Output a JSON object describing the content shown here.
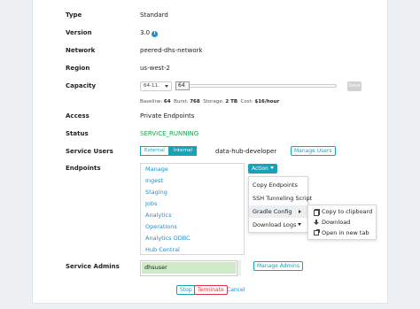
{
  "fields": {
    "type": {
      "label": "Type",
      "value": "Standard"
    },
    "version": {
      "label": "Version",
      "value": "3.0"
    },
    "network": {
      "label": "Network",
      "value": "peered-dhs-network"
    },
    "region": {
      "label": "Region",
      "value": "us-west-2"
    },
    "capacity": {
      "label": "Capacity",
      "select_value": "64-11.",
      "slider_value": "64",
      "save_label": "Save",
      "stats": {
        "baseline_label": "Baseline:",
        "baseline": "64",
        "burst_label": "Burst:",
        "burst": "768",
        "storage_label": "Storage:",
        "storage": "2 TB",
        "cost_label": "Cost:",
        "cost": "$16/hour"
      }
    },
    "access": {
      "label": "Access",
      "value": "Private Endpoints"
    },
    "status": {
      "label": "Status",
      "value": "SERVICE_RUNNING"
    },
    "service_users": {
      "label": "Service Users",
      "toggle_external": "External",
      "toggle_internal": "Internal",
      "user": "data-hub-developer",
      "manage_label": "Manage Users"
    },
    "endpoints": {
      "label": "Endpoints",
      "items": [
        "Manage",
        "Ingest",
        "Staging",
        "Jobs",
        "Analytics",
        "Operations",
        "Analytics ODBC",
        "Hub Central"
      ],
      "action_label": "Action"
    },
    "service_admins": {
      "label": "Service Admins",
      "admin": "dhsuser",
      "manage_label": "Manage Admins"
    }
  },
  "action_menu": {
    "items": [
      "Copy Endpoints",
      "SSH Tunneling Script",
      "Gradle Config",
      "Download Logs"
    ]
  },
  "submenu": {
    "items": [
      "Copy to clipboard",
      "Download",
      "Open in new tab"
    ]
  },
  "footer": {
    "stop_label": "Stop",
    "terminate_label": "Terminate",
    "cancel_label": "Cancel"
  },
  "colors": {
    "accent": "#17a2b8",
    "link": "#1a8fd0",
    "running": "#16a34a",
    "danger": "#dc3545"
  }
}
